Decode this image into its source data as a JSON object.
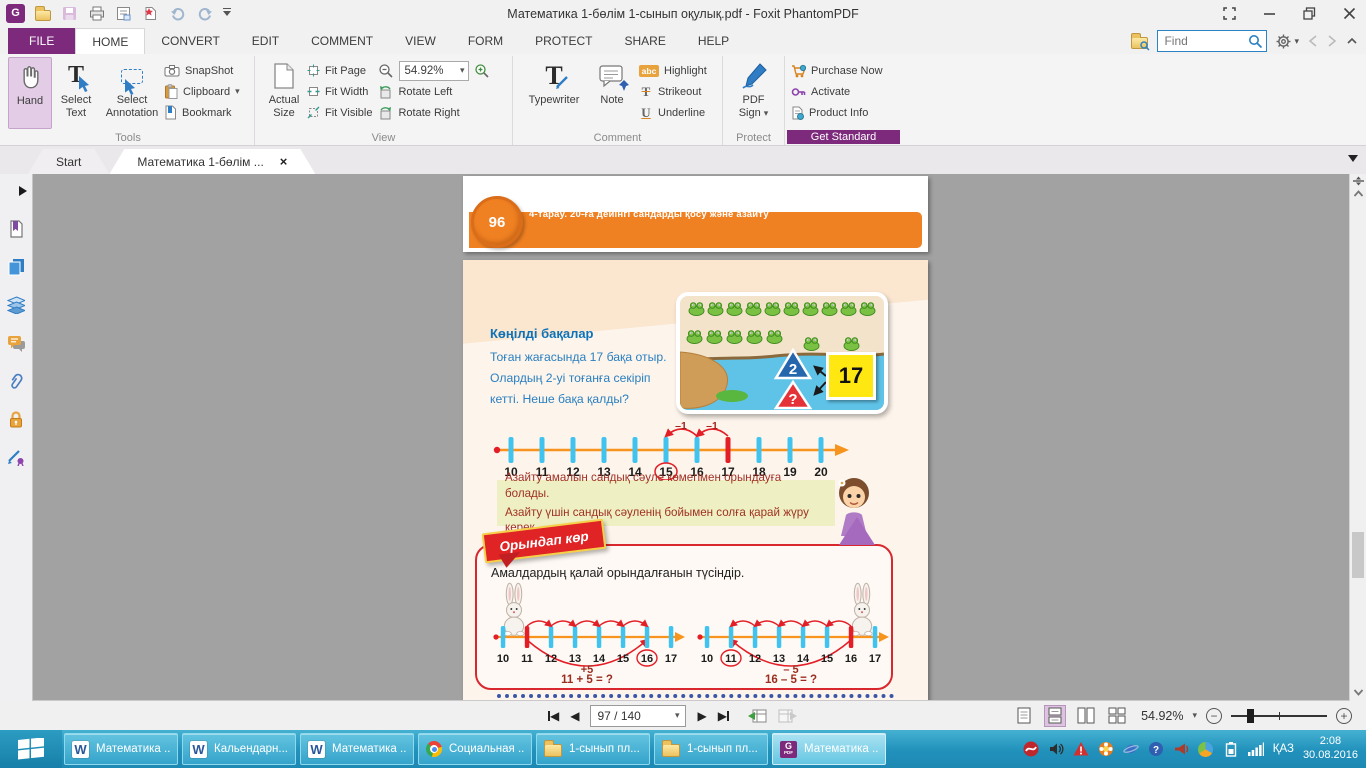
{
  "icons": {
    "dropdown": "▾",
    "close_tab": "×",
    "word_letter": "W",
    "foxit_letter": "G",
    "foxit_sub": "PDF",
    "abc": "abc",
    "strikeout_letter": "T",
    "underline_letter": "U",
    "typewriter_letter": "T",
    "select_text_letter": "T",
    "nav_prev": "◀",
    "nav_next": "▶",
    "zoom_out": "−",
    "zoom_in": "+"
  },
  "titlebar": {
    "title": "Математика 1-бөлім 1-сынып оқулық.pdf - Foxit PhantomPDF"
  },
  "menu_tabs": [
    "FILE",
    "HOME",
    "CONVERT",
    "EDIT",
    "COMMENT",
    "VIEW",
    "FORM",
    "PROTECT",
    "SHARE",
    "HELP"
  ],
  "find": {
    "placeholder": "Find"
  },
  "ribbon": {
    "tools": {
      "label": "Tools",
      "hand": "Hand",
      "select_text": "Select Text",
      "select_annotation": "Select Annotation",
      "snapshot": "SnapShot",
      "clipboard": "Clipboard",
      "bookmark": "Bookmark"
    },
    "view": {
      "label": "View",
      "actual_size": "Actual Size",
      "fit_page": "Fit Page",
      "fit_width": "Fit Width",
      "fit_visible": "Fit Visible",
      "zoom_value": "54.92%",
      "rotate_left": "Rotate Left",
      "rotate_right": "Rotate Right"
    },
    "comment": {
      "label": "Comment",
      "typewriter": "Typewriter",
      "note": "Note",
      "highlight": "Highlight",
      "strikeout": "Strikeout",
      "underline": "Underline"
    },
    "protect": {
      "label": "Protect",
      "pdf_sign": "PDF Sign"
    },
    "get_standard": {
      "label": "Get Standard",
      "purchase": "Purchase Now",
      "activate": "Activate",
      "product_info": "Product Info"
    }
  },
  "doc_tabs": {
    "start": "Start",
    "document": "Математика 1-бөлім ..."
  },
  "page96": {
    "number": "96",
    "chapter": "4-тарау. 20-ға дейінгі сандарды қосу және азайту"
  },
  "page97": {
    "problem": {
      "title": "Көңілді бақалар",
      "line1": "Тоған жағасында 17 бақа отыр.",
      "line2": "Олардың 2-уі тоғанға секіріп",
      "line3": "кетті. Неше бақа қалды?"
    },
    "pond": {
      "minuend": "17",
      "part_known": "2",
      "part_unknown": "?",
      "frog_row1": 10,
      "frog_row2": 5,
      "frog_jumping": 2
    },
    "numberline": {
      "labels": [
        "10",
        "11",
        "12",
        "13",
        "14",
        "15",
        "16",
        "17",
        "18",
        "19",
        "20"
      ],
      "hop_left": "–1",
      "hop_right": "–1"
    },
    "note": {
      "line1": "Азайту амалын сандық сәуле көмегімен орындауға болады.",
      "line2": "Азайту үшін сандық сәуленің бойымен солға қарай жүру керек."
    },
    "practice": {
      "badge": "Орындап көр",
      "task": "Амалдардың қалай орындалғанын түсіндір.",
      "left": {
        "labels": [
          "10",
          "11",
          "12",
          "13",
          "14",
          "15",
          "16",
          "17"
        ],
        "jump": "+5",
        "equation": "11 + 5 = ?"
      },
      "right": {
        "labels": [
          "10",
          "11",
          "12",
          "13",
          "14",
          "15",
          "16",
          "17"
        ],
        "jump": "– 5",
        "equation": "16 – 5 = ?"
      }
    }
  },
  "statusbar": {
    "page_field": "97 / 140",
    "zoom": "54.92%"
  },
  "taskbar": {
    "buttons": [
      "Математика ...",
      "Кальендарн...",
      "Математика ...",
      "Социальная ...",
      "1-сынып пл...",
      "1-сынып пл...",
      "Математика ..."
    ],
    "tray": {
      "lang": "ҚАЗ",
      "time": "2:08",
      "date": "30.08.2016"
    }
  }
}
